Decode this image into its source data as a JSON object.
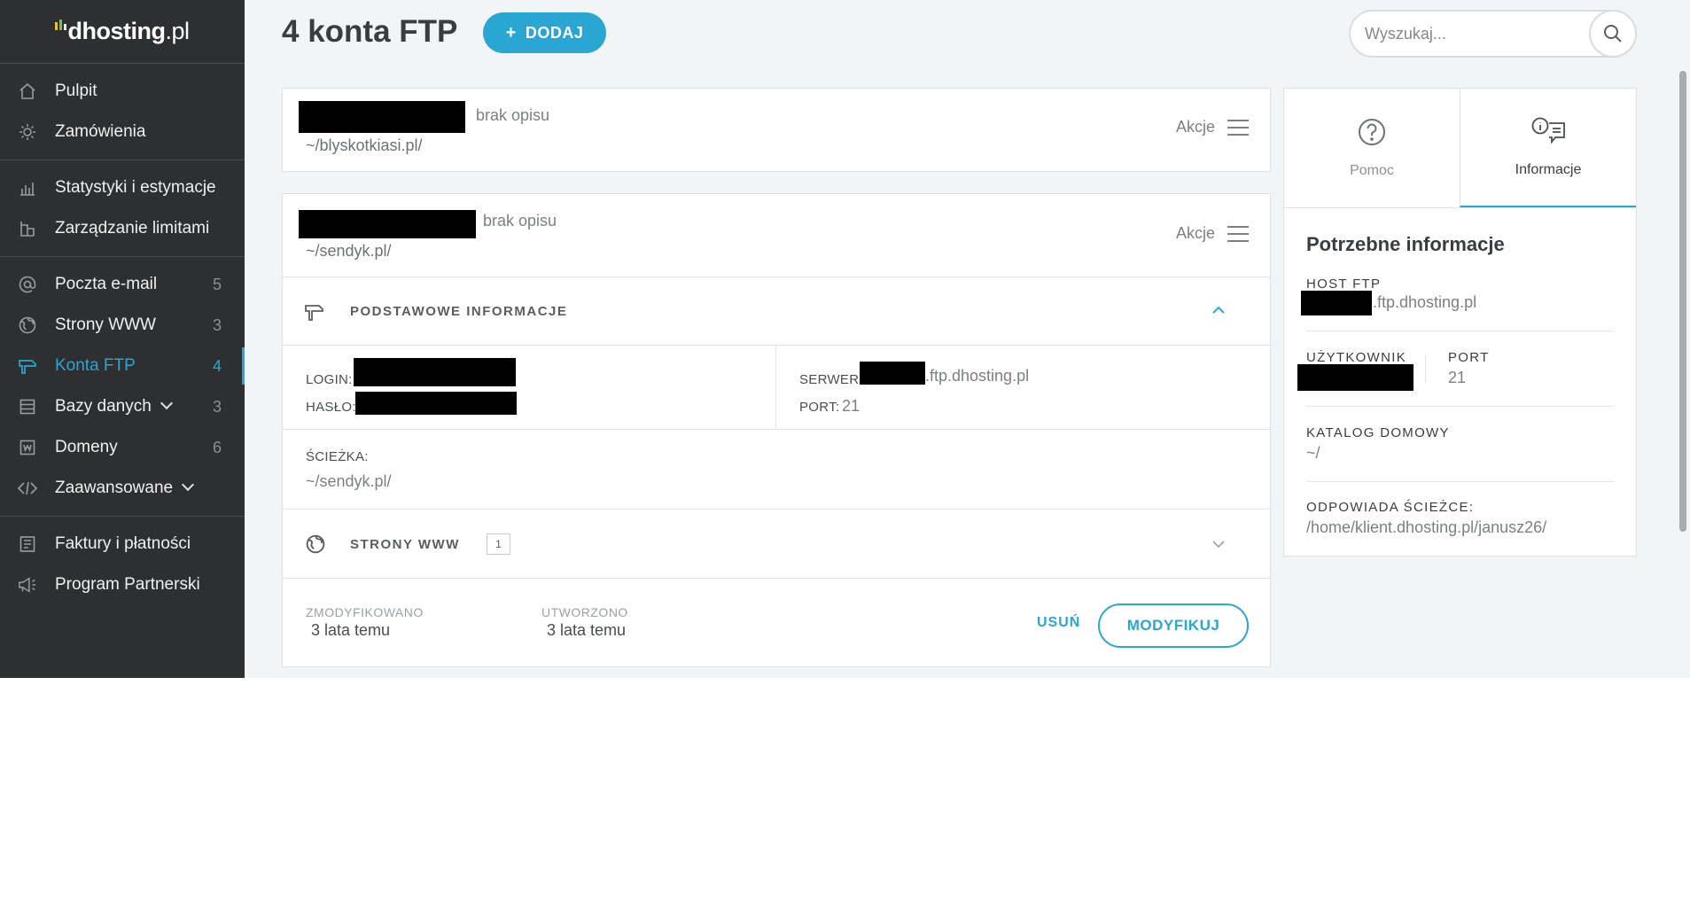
{
  "logo": {
    "brand": "dhosting",
    "tld": ".pl"
  },
  "sidebar": {
    "groups": [
      [
        {
          "label": "Pulpit",
          "icon": "home-icon"
        },
        {
          "label": "Zamówienia",
          "icon": "bulb-icon"
        }
      ],
      [
        {
          "label": "Statystyki i estymacje",
          "icon": "chart-icon"
        },
        {
          "label": "Zarządzanie limitami",
          "icon": "limits-icon"
        }
      ],
      [
        {
          "label": "Poczta e-mail",
          "icon": "at-icon",
          "count": "5"
        },
        {
          "label": "Strony WWW",
          "icon": "globe-icon",
          "count": "3"
        },
        {
          "label": "Konta FTP",
          "icon": "ftp-icon",
          "count": "4",
          "active": true
        },
        {
          "label": "Bazy danych",
          "icon": "database-icon",
          "count": "3",
          "dropdown": true
        },
        {
          "label": "Domeny",
          "icon": "domain-icon",
          "count": "6"
        },
        {
          "label": "Zaawansowane",
          "icon": "code-icon",
          "dropdown": true
        }
      ],
      [
        {
          "label": "Faktury i płatności",
          "icon": "invoice-icon"
        },
        {
          "label": "Program Partnerski",
          "icon": "megaphone-icon"
        }
      ]
    ]
  },
  "header": {
    "title": "4 konta FTP",
    "add_label": "DODAJ",
    "search_placeholder": "Wyszukaj..."
  },
  "accounts": [
    {
      "description": "brak opisu",
      "path": "~/blyskotkiasi.pl/",
      "actions_label": "Akcje"
    },
    {
      "description": "brak opisu",
      "path": "~/sendyk.pl/",
      "actions_label": "Akcje"
    }
  ],
  "details": {
    "basic_section": "PODSTAWOWE INFORMACJE",
    "login_label": "LOGIN:",
    "password_label": "HASŁO:",
    "server_label": "SERWER:",
    "server_value": ".ftp.dhosting.pl",
    "port_label": "PORT:",
    "port_value": "21",
    "path_label": "ŚCIEŻKA:",
    "path_value": "~/sendyk.pl/",
    "www_section": "STRONY WWW",
    "www_count": "1",
    "modified_label": "ZMODYFIKOWANO",
    "modified_value": "3 lata temu",
    "created_label": "UTWORZONO",
    "created_value": "3 lata temu",
    "delete_label": "USUŃ",
    "modify_label": "MODYFIKUJ"
  },
  "right_panel": {
    "tabs": [
      {
        "label": "Pomoc",
        "icon": "help-circle-icon"
      },
      {
        "label": "Informacje",
        "icon": "info-chat-icon",
        "active": true
      }
    ],
    "title": "Potrzebne informacje",
    "host_label": "HOST FTP",
    "host_value": ".ftp.dhosting.pl",
    "user_label": "UŻYTKOWNIK",
    "port_label": "PORT",
    "port_value": "21",
    "home_label": "KATALOG DOMOWY",
    "home_value": "~/",
    "path_label": "ODPOWIADA ŚCIEŻCE:",
    "path_value": "/home/klient.dhosting.pl/janusz26/"
  },
  "colors": {
    "accent": "#2aa6d2",
    "sidebar_bg": "#2d2f31",
    "page_bg": "#f2f5f8"
  }
}
